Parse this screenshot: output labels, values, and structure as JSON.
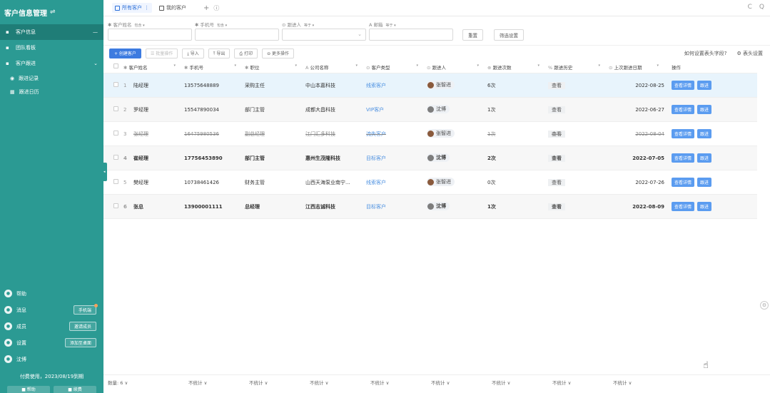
{
  "sidebar": {
    "title": "客户信息管理",
    "toggle_icon": "⇌",
    "items": [
      {
        "label": "客户信息",
        "icon": "user-card-icon",
        "active": true,
        "right": "—"
      },
      {
        "label": "团队看板",
        "icon": "chart-icon"
      },
      {
        "label": "客户跟进",
        "icon": "folder-icon",
        "right": "⌄"
      }
    ],
    "subitems": [
      {
        "label": "跟进记录",
        "icon": "eye-icon"
      },
      {
        "label": "跟进日历",
        "icon": "calendar-icon"
      }
    ],
    "bottom": [
      {
        "label": "帮助",
        "icon": "help-icon"
      },
      {
        "label": "消息",
        "icon": "message-icon",
        "pill": "手机端"
      },
      {
        "label": "成员",
        "icon": "members-icon",
        "pill": "邀请成员"
      },
      {
        "label": "设置",
        "icon": "settings-icon",
        "pill": "添加至桌面"
      },
      {
        "label": "沈博",
        "icon": "avatar-icon"
      }
    ],
    "payment": "付费使用，2023/08/19到期",
    "bottom_btns": [
      "■ 帮助",
      "■ 续费"
    ]
  },
  "tabs": [
    {
      "label": "所有客户",
      "more": "⋮",
      "active": true
    },
    {
      "label": "我的客户"
    }
  ],
  "tab_add": "+",
  "tab_info": "ⓘ",
  "top_right": [
    "C",
    "Q"
  ],
  "filters": [
    {
      "label": "客户姓名",
      "op": "包含 ▾"
    },
    {
      "label": "手机号",
      "op": "包含 ▾"
    },
    {
      "label": "跟进人",
      "op": "等于 ▾"
    },
    {
      "label": "邮箱",
      "op": "等于 ▾"
    }
  ],
  "filter_buttons": {
    "reset": "重置",
    "settings": "筛选设置"
  },
  "toolbar": {
    "create": "+ 创建客户",
    "batch": "☰ 批量操作",
    "import": "⤓ 导入",
    "export": "⤒ 导出",
    "print": "⎙ 打印",
    "more": "⊖ 更多操作",
    "help_link": "如何设置表头字段?",
    "col_settings": "⚙ 表头设置"
  },
  "columns": [
    {
      "label": "客户姓名",
      "icon": "✱"
    },
    {
      "label": "手机号",
      "icon": "✱"
    },
    {
      "label": "职位",
      "icon": "✱"
    },
    {
      "label": "公司名称",
      "icon": "A"
    },
    {
      "label": "客户类型",
      "icon": "⊙"
    },
    {
      "label": "跟进人",
      "icon": "⊙"
    },
    {
      "label": "跟进次数",
      "icon": "⊕"
    },
    {
      "label": "跟进历史",
      "icon": "%"
    },
    {
      "label": "上次跟进日期",
      "icon": "⊙"
    },
    {
      "label": "操作",
      "icon": ""
    }
  ],
  "rows": [
    {
      "idx": "1",
      "name": "陆经理",
      "phone": "13575648889",
      "position": "采购主任",
      "company": "中山本嘉科技",
      "type": "线索客户",
      "follower": "张智进",
      "av": "a1",
      "count": "6次",
      "history": "查看",
      "date": "2022-08-25",
      "style": "sel"
    },
    {
      "idx": "2",
      "name": "罗经理",
      "phone": "15547890034",
      "position": "部门主管",
      "company": "成都大昌科技",
      "type": "VIP客户",
      "follower": "沈博",
      "av": "a2",
      "count": "1次",
      "history": "查看",
      "date": "2022-06-27",
      "style": "alt"
    },
    {
      "idx": "3",
      "name": "张经理",
      "phone": "16475980536",
      "position": "副总经理",
      "company": "江门汇多科技",
      "type": "流失客户",
      "follower": "张智进",
      "av": "a1",
      "count": "1次",
      "history": "查看",
      "date": "2022-08-04",
      "style": "strike"
    },
    {
      "idx": "4",
      "name": "崔经理",
      "phone": "17756453890",
      "position": "部门主管",
      "company": "惠州生茂隆科技",
      "type": "目标客户",
      "follower": "沈博",
      "av": "a2",
      "count": "2次",
      "history": "查看",
      "date": "2022-07-05",
      "style": "alt bold"
    },
    {
      "idx": "5",
      "name": "樊经理",
      "phone": "10738461426",
      "position": "财务主管",
      "company": "山西天海泵业南宁...",
      "type": "线索客户",
      "follower": "张智进",
      "av": "a1",
      "count": "0次",
      "history": "查看",
      "date": "2022-07-26",
      "style": ""
    },
    {
      "idx": "6",
      "name": "张总",
      "phone": "13900001111",
      "position": "总经理",
      "company": "江西志诚科技",
      "type": "目标客户",
      "follower": "沈博",
      "av": "a2",
      "count": "1次",
      "history": "查看",
      "date": "2022-08-09",
      "style": "alt bold"
    }
  ],
  "row_actions": {
    "detail": "查看详情",
    "follow": "跟进"
  },
  "footer": [
    "数量: 6 ∨",
    "不统计 ∨",
    "不统计 ∨",
    "不统计 ∨",
    "不统计 ∨",
    "不统计 ∨",
    "不统计 ∨",
    "不统计 ∨",
    "不统计 ∨"
  ]
}
